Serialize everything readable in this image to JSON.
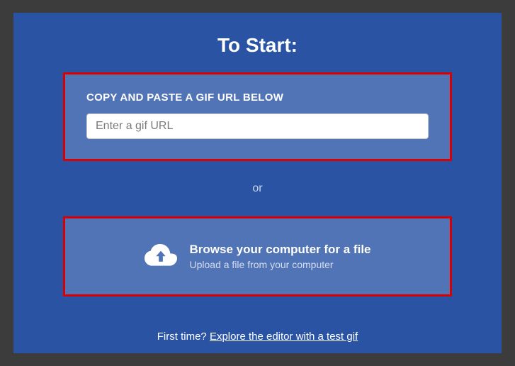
{
  "heading": "To Start:",
  "url_section": {
    "label": "COPY AND PASTE A GIF URL BELOW",
    "placeholder": "Enter a gif URL"
  },
  "or_text": "or",
  "browse_section": {
    "title": "Browse your computer for a file",
    "subtitle": "Upload a file from your computer"
  },
  "footer": {
    "prefix": "First time? ",
    "link_text": "Explore the editor with a test gif"
  }
}
